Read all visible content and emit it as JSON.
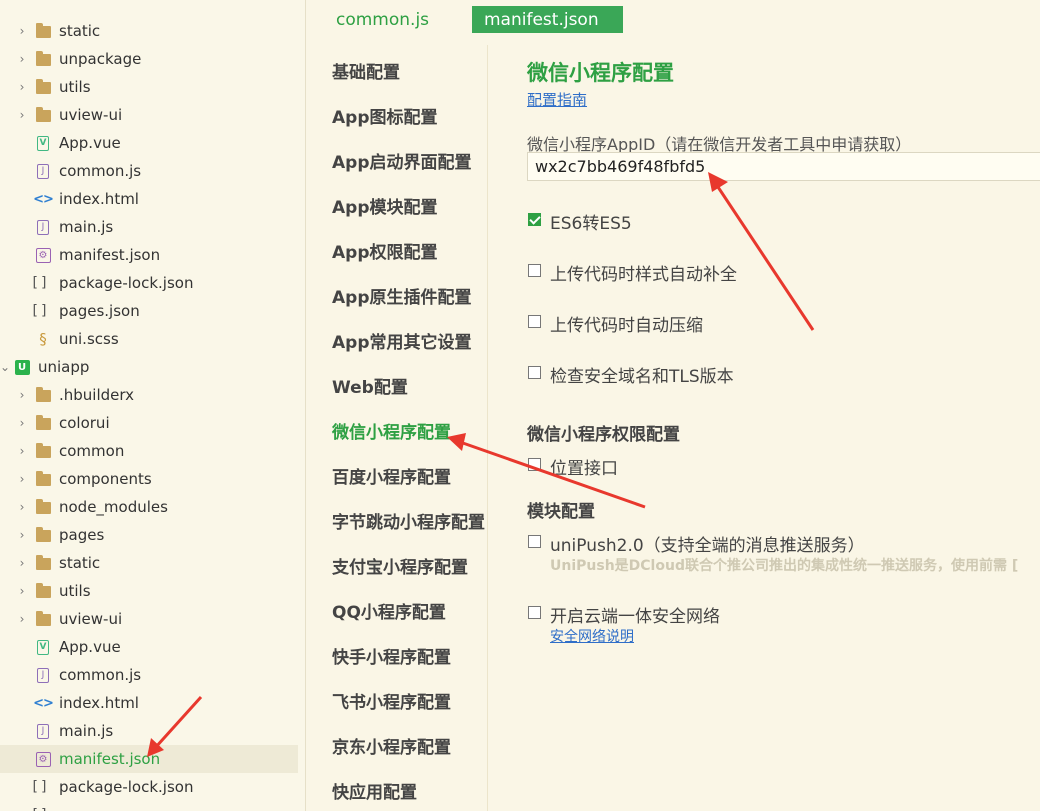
{
  "tree": {
    "items": [
      {
        "name": "static",
        "type": "folder"
      },
      {
        "name": "unpackage",
        "type": "folder"
      },
      {
        "name": "utils",
        "type": "folder"
      },
      {
        "name": "uview-ui",
        "type": "folder"
      },
      {
        "name": "App.vue",
        "type": "vue"
      },
      {
        "name": "common.js",
        "type": "js"
      },
      {
        "name": "index.html",
        "type": "html"
      },
      {
        "name": "main.js",
        "type": "js"
      },
      {
        "name": "manifest.json",
        "type": "manifest"
      },
      {
        "name": "package-lock.json",
        "type": "json"
      },
      {
        "name": "pages.json",
        "type": "json"
      },
      {
        "name": "uni.scss",
        "type": "scss"
      },
      {
        "name": "uniapp",
        "type": "project"
      },
      {
        "name": ".hbuilderx",
        "type": "folder"
      },
      {
        "name": "colorui",
        "type": "folder"
      },
      {
        "name": "common",
        "type": "folder"
      },
      {
        "name": "components",
        "type": "folder"
      },
      {
        "name": "node_modules",
        "type": "folder"
      },
      {
        "name": "pages",
        "type": "folder"
      },
      {
        "name": "static",
        "type": "folder"
      },
      {
        "name": "utils",
        "type": "folder"
      },
      {
        "name": "uview-ui",
        "type": "folder"
      },
      {
        "name": "App.vue",
        "type": "vue"
      },
      {
        "name": "common.js",
        "type": "js"
      },
      {
        "name": "index.html",
        "type": "html"
      },
      {
        "name": "main.js",
        "type": "js"
      },
      {
        "name": "manifest.json",
        "type": "manifest",
        "selected": true
      },
      {
        "name": "package-lock.json",
        "type": "json"
      }
    ]
  },
  "tabs": {
    "common": "common.js",
    "manifest": "manifest.json"
  },
  "nav": {
    "items": [
      "基础配置",
      "App图标配置",
      "App启动界面配置",
      "App模块配置",
      "App权限配置",
      "App原生插件配置",
      "App常用其它设置",
      "Web配置",
      "微信小程序配置",
      "百度小程序配置",
      "字节跳动小程序配置",
      "支付宝小程序配置",
      "QQ小程序配置",
      "快手小程序配置",
      "飞书小程序配置",
      "京东小程序配置",
      "快应用配置"
    ],
    "active_index": 8
  },
  "panel": {
    "title": "微信小程序配置",
    "guide_link": "配置指南",
    "appid_label": "微信小程序AppID（请在微信开发者工具中申请获取）",
    "appid_value": "wx2c7bb469f48fbfd5",
    "options": {
      "es6": {
        "label": "ES6转ES5",
        "checked": true
      },
      "postcss": {
        "label": "上传代码时样式自动补全",
        "checked": false
      },
      "minify": {
        "label": "上传代码时自动压缩",
        "checked": false
      },
      "domain": {
        "label": "检查安全域名和TLS版本",
        "checked": false
      }
    },
    "permission_heading": "微信小程序权限配置",
    "location": {
      "label": "位置接口",
      "checked": false
    },
    "module_heading": "模块配置",
    "unipush": {
      "label": "uniPush2.0（支持全端的消息推送服务）",
      "checked": false
    },
    "unipush_desc": "UniPush是DCloud联合个推公司推出的集成性统一推送服务，使用前需 [",
    "secure": {
      "label": "开启云端一体安全网络",
      "checked": false
    },
    "secure_link": "安全网络说明"
  },
  "colors": {
    "accent": "#2ea043",
    "tab_active": "#3aa757",
    "arrow": "#e8382d"
  }
}
